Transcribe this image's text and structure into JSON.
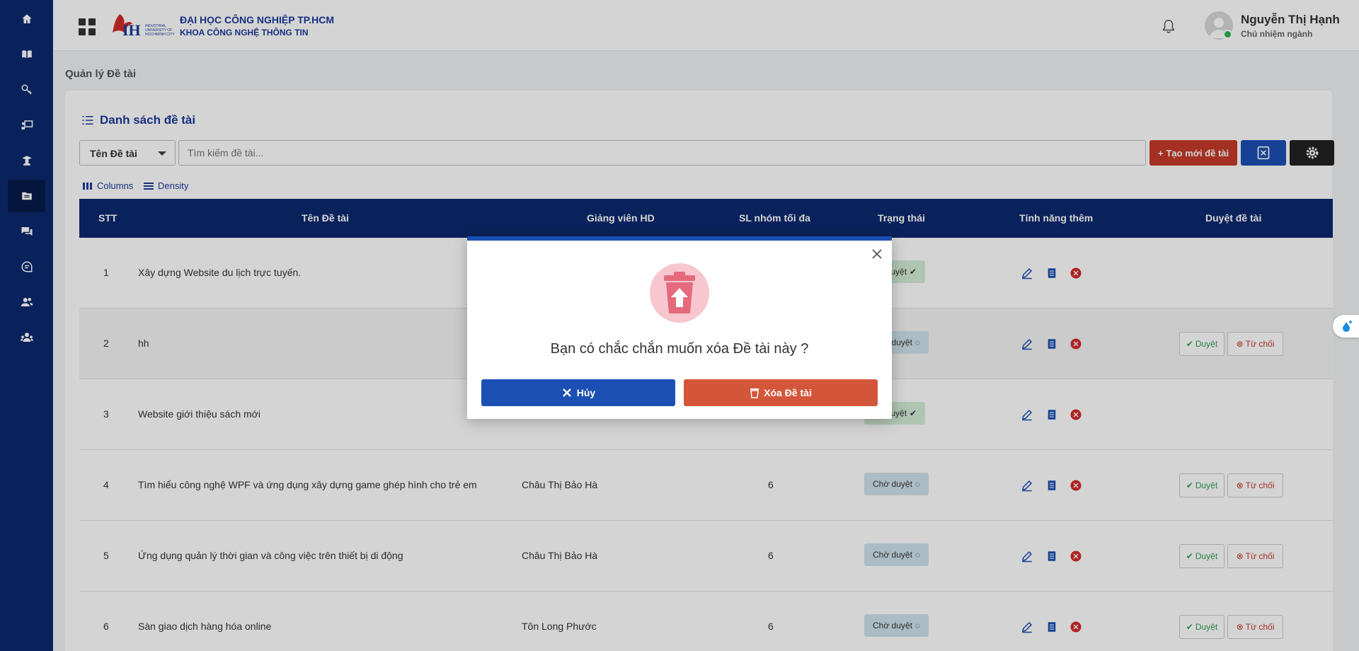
{
  "header": {
    "university": "ĐẠI HỌC CÔNG NGHIỆP TP.HCM",
    "faculty": "KHOA CÔNG NGHỆ THÔNG TIN",
    "user_name": "Nguyễn Thị Hạnh",
    "user_role": "Chủ nhiệm ngành"
  },
  "page": {
    "title": "Quản lý Đề tài",
    "list_title": "Danh sách đề tài"
  },
  "toolbar": {
    "filter_value": "Tên Đề tài",
    "search_placeholder": "Tìm kiếm đề tài...",
    "create_label": "Tạo mới đề tài",
    "columns_label": "Columns",
    "density_label": "Density"
  },
  "table": {
    "headers": [
      "STT",
      "Tên Đề tài",
      "Giảng viên HD",
      "SL nhóm tối đa",
      "Trạng thái",
      "Tính năng thêm",
      "Duyệt đề tài"
    ],
    "approve_label": "Duyệt",
    "reject_label": "Từ chối",
    "rows": [
      {
        "stt": "1",
        "name": "Xây dựng Website du lịch trực tuyến.",
        "lecturer": "",
        "max": "",
        "status": "Đã duyệt"
      },
      {
        "stt": "2",
        "name": "hh",
        "lecturer": "",
        "max": "",
        "status": "Chờ duyệt"
      },
      {
        "stt": "3",
        "name": "Website giới thiệu sách mới",
        "lecturer": "",
        "max": "",
        "status": "Đã duyệt"
      },
      {
        "stt": "4",
        "name": "Tìm hiểu công nghệ WPF và ứng dụng xây dựng game ghép hình cho trẻ em",
        "lecturer": "Châu Thị Bảo Hà",
        "max": "6",
        "status": "Chờ duyệt"
      },
      {
        "stt": "5",
        "name": "Ứng dụng quản lý thời gian và công việc trên thiết bị di động",
        "lecturer": "Châu Thị Bảo Hà",
        "max": "6",
        "status": "Chờ duyệt"
      },
      {
        "stt": "6",
        "name": "Sàn giao dịch hàng hóa online",
        "lecturer": "Tôn Long Phước",
        "max": "6",
        "status": "Chờ duyệt"
      }
    ]
  },
  "modal": {
    "message": "Bạn có chắc chắn muốn xóa Đề tài này ?",
    "cancel_label": "Hủy",
    "delete_label": "Xóa Đề tài"
  },
  "colors": {
    "sidebar": "#0d2a6e",
    "primary": "#1b4fb3",
    "danger": "#c43a2a"
  }
}
